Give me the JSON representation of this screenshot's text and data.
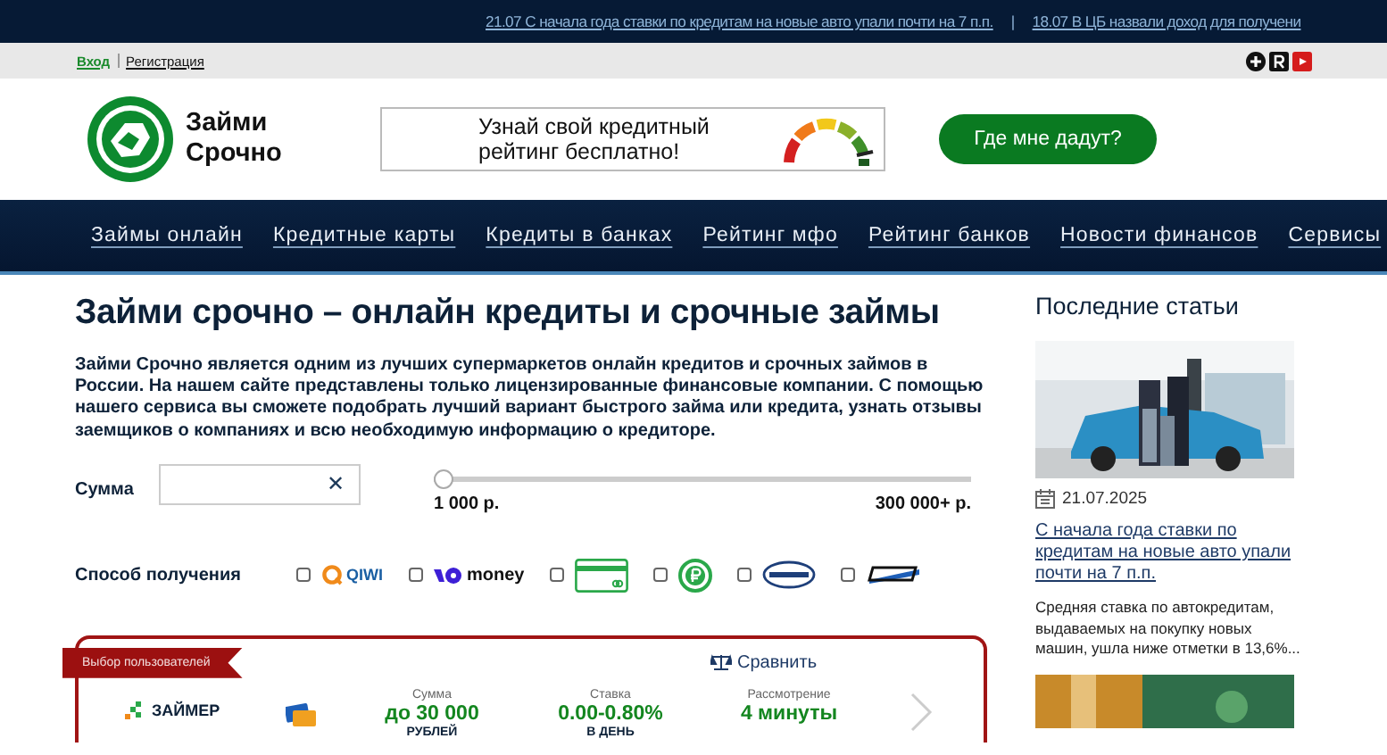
{
  "ticker": {
    "items": [
      "21.07 С начала года ставки по кредитам на новые авто упали почти на 7 п.п.",
      "18.07 В ЦБ назвали доход для получени"
    ],
    "separator": "|"
  },
  "auth": {
    "login": "Вход",
    "register": "Регистрация"
  },
  "logo": {
    "line1": "Займи",
    "line2": "Срочно"
  },
  "banner": {
    "text_line1": "Узнай свой кредитный",
    "text_line2": "рейтинг бесплатно!"
  },
  "cta_button": "Где мне дадут?",
  "nav": [
    "Займы онлайн",
    "Кредитные карты",
    "Кредиты в банках",
    "Рейтинг мфо",
    "Рейтинг банков",
    "Новости финансов",
    "Сервисы"
  ],
  "page_title": "Займи срочно – онлайн кредиты и срочные займы",
  "intro": "Займи Срочно является одним из лучших супермаркетов онлайн кредитов и срочных займов в России. На нашем сайте представлены только лицензированные финансовые компании. С помощью нашего сервиса вы сможете подобрать лучший вариант быстрого займа или кредита, узнать отзывы заемщиков о компаниях и всю необходимую информацию о кредиторе.",
  "amount": {
    "label": "Сумма",
    "clear": "✕",
    "level": 0,
    "min_label": "1 000 р.",
    "max_label": "300 000+ р."
  },
  "methods": {
    "label": "Способ получения",
    "options": [
      {
        "kind": "qiwi",
        "text": "QIWI",
        "checked": false
      },
      {
        "kind": "money",
        "text": "money",
        "checked": false
      },
      {
        "kind": "card",
        "checked": false
      },
      {
        "kind": "ruble",
        "checked": false
      },
      {
        "kind": "unistream",
        "checked": false
      },
      {
        "kind": "contact",
        "checked": false
      }
    ]
  },
  "offer": {
    "badge": "Выбор пользователей",
    "compare": "Сравнить",
    "lender": "ЗАЙМЕР",
    "columns": [
      {
        "label": "Сумма",
        "value": "до 30 000",
        "unit": "РУБЛЕЙ"
      },
      {
        "label": "Ставка",
        "value": "0.00-0.80%",
        "unit": "В ДЕНЬ"
      },
      {
        "label": "Рассмотрение",
        "value": "4 минуты"
      }
    ]
  },
  "sidebar": {
    "title": "Последние статьи",
    "articles": [
      {
        "date": "21.07.2025",
        "title": "С начала года ставки по кредитам на новые авто упали почти на 7 п.п.",
        "excerpt": "Средняя ставка по автокредитам, выдаваемых на покупку новых машин, ушла ниже отметки в 13,6%..."
      }
    ]
  }
}
